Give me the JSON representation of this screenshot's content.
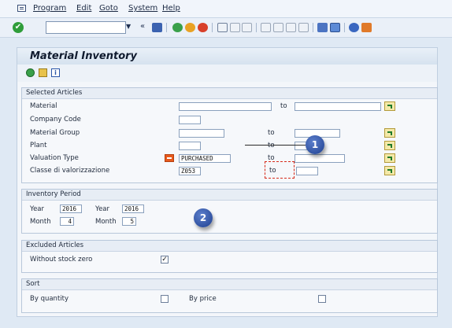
{
  "menu": {
    "items": [
      {
        "id": "program",
        "label": "Program"
      },
      {
        "id": "edit",
        "label": "Edit"
      },
      {
        "id": "goto",
        "label": "Goto"
      },
      {
        "id": "system",
        "label": "System"
      },
      {
        "id": "help",
        "label": "Help"
      }
    ]
  },
  "toolbar": {
    "command_field_value": "",
    "enter_icon": "check-icon",
    "history_icon": "double-left-chevron-icon"
  },
  "screen": {
    "title": "Material Inventory",
    "app_toolbar_icons": [
      "execute-icon",
      "get-variant-icon",
      "info-icon"
    ]
  },
  "selected_articles": {
    "title": "Selected Articles",
    "rows": [
      {
        "label": "Material",
        "from": "",
        "to_label": "to",
        "to": ""
      },
      {
        "label": "Company Code",
        "from": ""
      },
      {
        "label": "Material Group",
        "from": "",
        "to_label": "to",
        "to": ""
      },
      {
        "label": "Plant",
        "from": "",
        "to_label": "to",
        "to": ""
      },
      {
        "label": "Valuation Type",
        "from": "PURCHASED",
        "to_label": "to",
        "to": ""
      },
      {
        "label": "Classe di valorizzazione",
        "from": "Z053",
        "to_label": "to",
        "to": ""
      }
    ]
  },
  "inventory_period": {
    "title": "Inventory Period",
    "year_label_1": "Year",
    "year_value_1": "2016",
    "year_label_2": "Year",
    "year_value_2": "2016",
    "month_label_1": "Month",
    "month_value_1": "4",
    "month_label_2": "Month",
    "month_value_2": "5"
  },
  "excluded_articles": {
    "title": "Excluded Articles",
    "without_stock_zero_label": "Without stock zero",
    "without_stock_zero_checked": true,
    "without_stock_zero_mark": "✓"
  },
  "sort": {
    "title": "Sort",
    "by_quantity_label": "By quantity",
    "by_quantity_checked": false,
    "by_price_label": "By price",
    "by_price_checked": false
  },
  "callouts": {
    "c1": "1",
    "c2": "2"
  },
  "colors": {
    "required_marker": "#e85a1c",
    "callout": "#2a4ea3",
    "highlight_bracket": "#d62a1a"
  }
}
